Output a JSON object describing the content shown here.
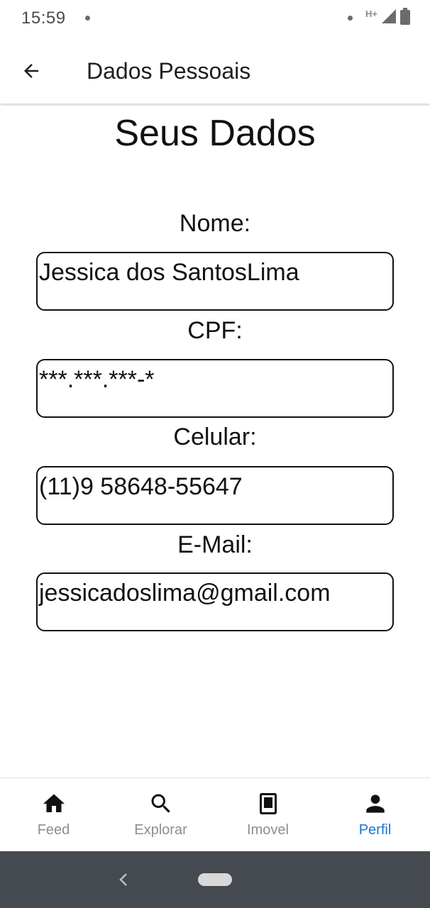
{
  "status_bar": {
    "time": "15:59",
    "network": "H+",
    "icons": [
      "notification-dot-icon",
      "signal-icon",
      "battery-icon"
    ]
  },
  "app_bar": {
    "title": "Dados Pessoais",
    "back_icon": "arrow-back-icon"
  },
  "main": {
    "heading": "Seus Dados",
    "fields": [
      {
        "label": "Nome:",
        "value": "Jessica dos SantosLima"
      },
      {
        "label": "CPF:",
        "value": "***.***.***-*"
      },
      {
        "label": "Celular:",
        "value": "(11)9 58648-55647"
      },
      {
        "label": "E-Mail:",
        "value": "jessicadoslima@gmail.com"
      }
    ]
  },
  "bottom_nav": {
    "items": [
      {
        "label": "Feed",
        "icon": "home-icon",
        "active": false
      },
      {
        "label": "Explorar",
        "icon": "search-icon",
        "active": false
      },
      {
        "label": "Imovel",
        "icon": "tablet-icon",
        "active": false
      },
      {
        "label": "Perfil",
        "icon": "person-icon",
        "active": true
      }
    ],
    "active_color": "#1976d2",
    "inactive_color": "#8e8e8e"
  },
  "system_nav": {
    "icons": [
      "system-back-icon",
      "home-pill-icon"
    ],
    "background": "#454a50"
  }
}
